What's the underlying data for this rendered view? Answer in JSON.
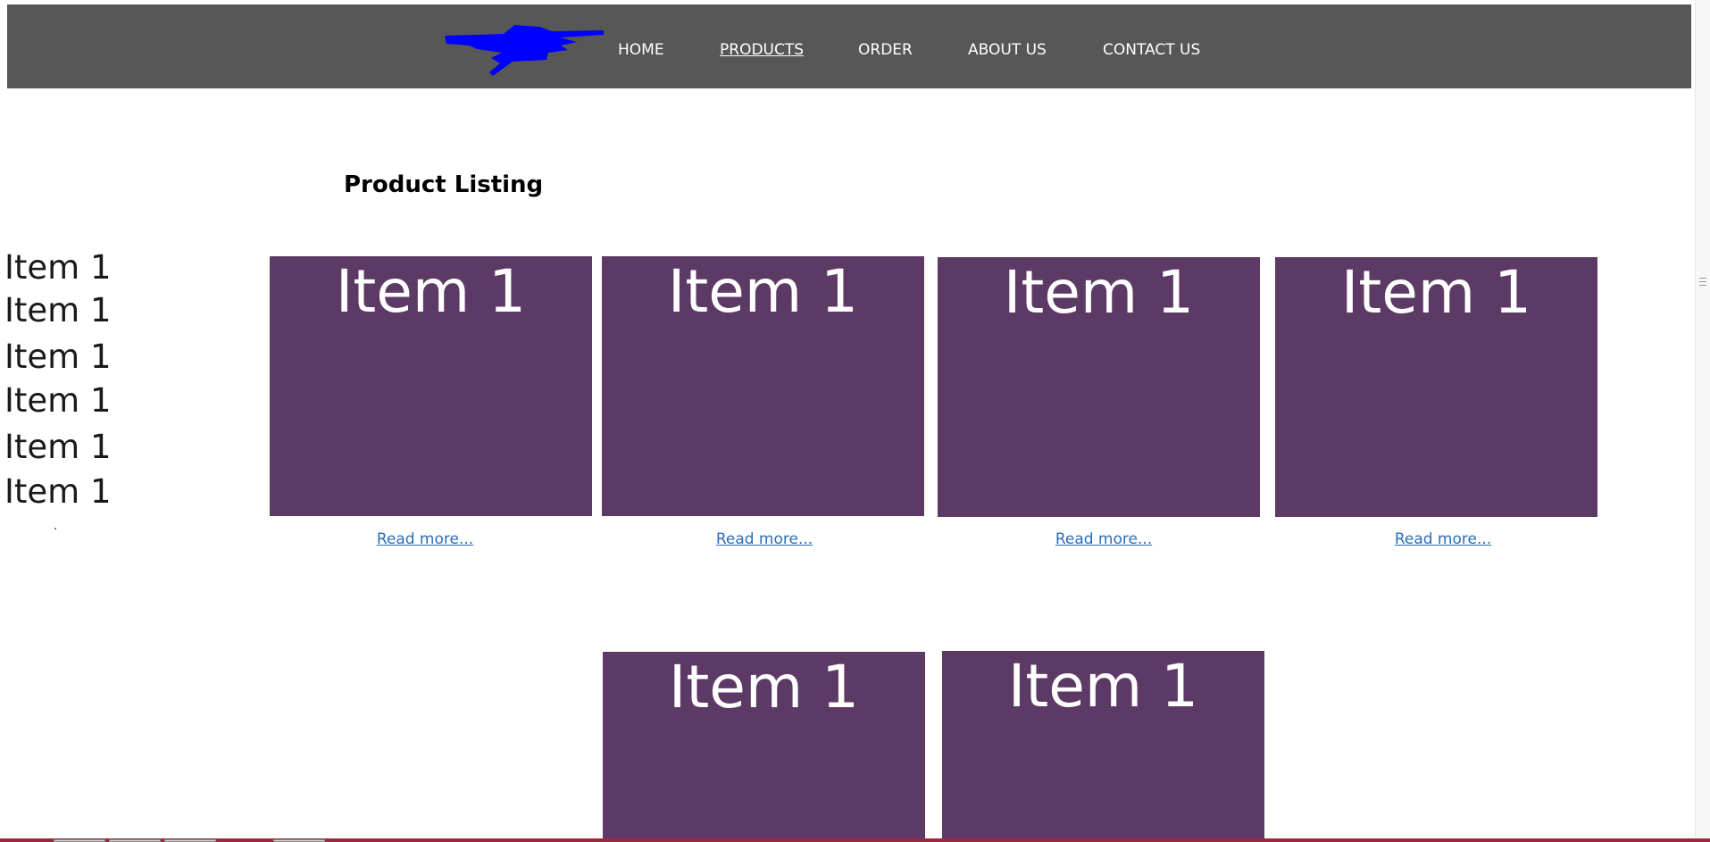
{
  "header": {
    "nav": [
      {
        "label": "HOME",
        "active": false
      },
      {
        "label": "PRODUCTS",
        "active": true
      },
      {
        "label": "ORDER",
        "active": false
      },
      {
        "label": "ABOUT US",
        "active": false
      },
      {
        "label": "CONTACT US",
        "active": false
      }
    ],
    "logo_color": "#0000ff",
    "background": "#575757"
  },
  "main": {
    "title": "Product Listing",
    "side_items": [
      "Item 1",
      "Item 1",
      "Item 1",
      "Item 1",
      "Item 1",
      "Item 1"
    ],
    "products": [
      {
        "label": "Item 1",
        "link": "Read more..."
      },
      {
        "label": "Item 1",
        "link": "Read more..."
      },
      {
        "label": "Item 1",
        "link": "Read more..."
      },
      {
        "label": "Item 1",
        "link": "Read more..."
      },
      {
        "label": "Item 1"
      },
      {
        "label": "Item 1"
      }
    ],
    "card_color": "#5d3a66",
    "link_color": "#2a6ebb"
  }
}
